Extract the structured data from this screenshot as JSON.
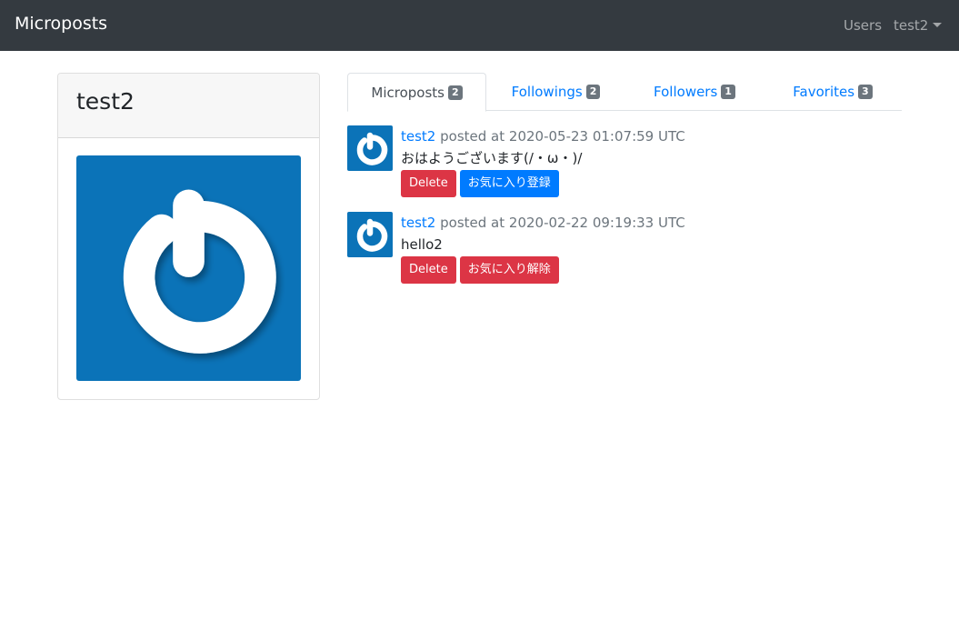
{
  "navbar": {
    "brand": "Microposts",
    "users_link": "Users",
    "user_menu": "test2"
  },
  "profile": {
    "name": "test2"
  },
  "tabs": [
    {
      "label": "Microposts",
      "count": "2",
      "active": true
    },
    {
      "label": "Followings",
      "count": "2",
      "active": false
    },
    {
      "label": "Followers",
      "count": "1",
      "active": false
    },
    {
      "label": "Favorites",
      "count": "3",
      "active": false
    }
  ],
  "posts": [
    {
      "user": "test2",
      "posted_at": "posted at 2020-05-23 01:07:59 UTC",
      "content": "おはようございます(/・ω・)/",
      "delete_label": "Delete",
      "favorite_label": "お気に入り登録"
    },
    {
      "user": "test2",
      "posted_at": "posted at 2020-02-22 09:19:33 UTC",
      "content": "hello2",
      "delete_label": "Delete",
      "favorite_label": "お気に入り解除"
    }
  ],
  "colors": {
    "navbar_bg": "#343a40",
    "primary": "#007bff",
    "danger": "#dc3545",
    "avatar_bg": "#0b73b8"
  },
  "icons": {
    "avatar": "power-icon",
    "user_menu": "caret-down-icon"
  }
}
